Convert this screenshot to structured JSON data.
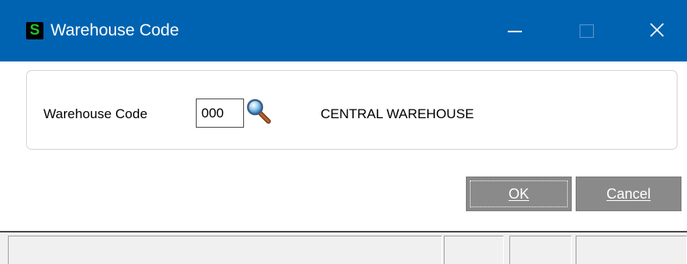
{
  "window": {
    "title": "Warehouse Code",
    "app_icon_letter": "S",
    "colors": {
      "titlebar": "#0063b1",
      "app_icon_letter": "#22c32e",
      "button_bg": "#8a8a8a"
    },
    "controls": [
      "minimize-icon",
      "maximize-icon",
      "close-icon"
    ]
  },
  "form": {
    "field_label": "Warehouse Code",
    "code_value": "000",
    "lookup_icon": "magnifier-icon",
    "warehouse_name": "CENTRAL WAREHOUSE"
  },
  "buttons": {
    "ok_label": "OK",
    "cancel_label": "Cancel"
  },
  "statusbar": {
    "cells": [
      "",
      "",
      "",
      ""
    ]
  }
}
